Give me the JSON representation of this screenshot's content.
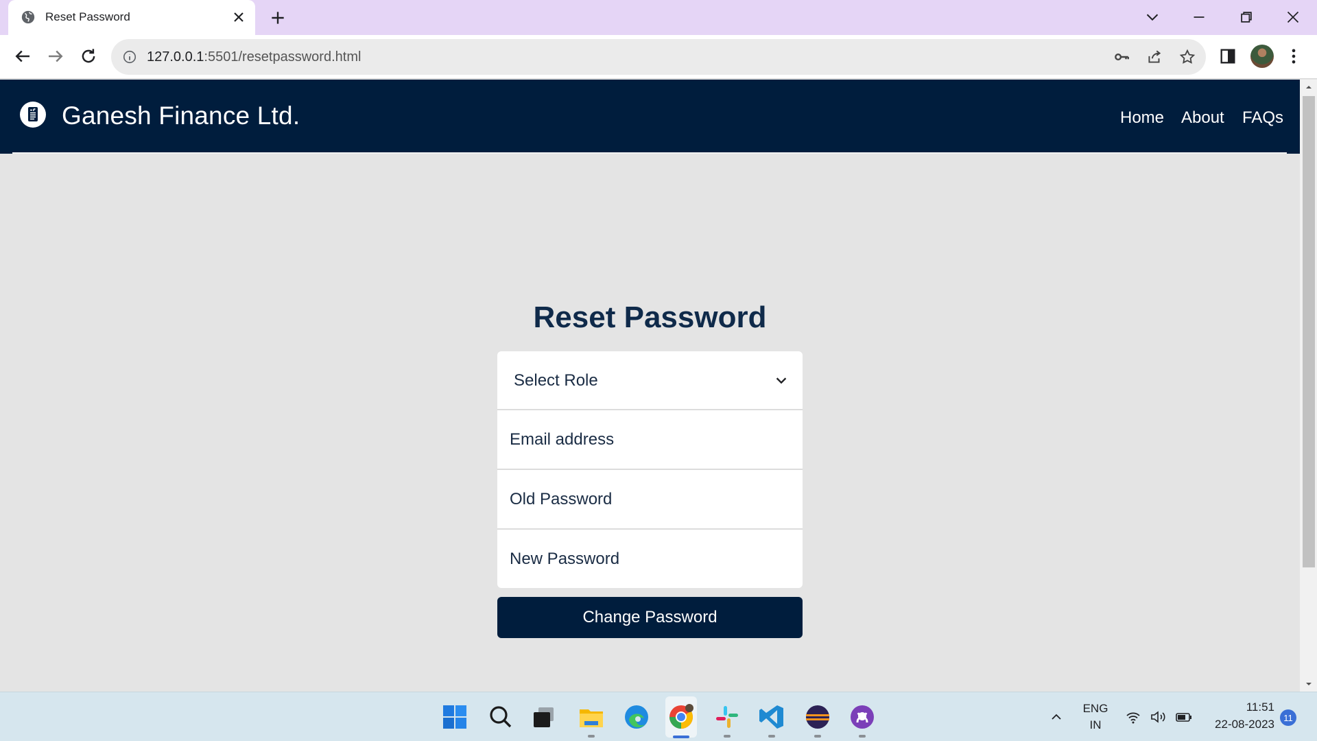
{
  "browser": {
    "tab_title": "Reset Password",
    "url_host": "127.0.0.1",
    "url_rest": ":5501/resetpassword.html"
  },
  "site": {
    "brand": "Ganesh Finance Ltd.",
    "nav": [
      {
        "label": "Home"
      },
      {
        "label": "About"
      },
      {
        "label": "FAQs"
      }
    ],
    "colors": {
      "navbar": "#001d3d",
      "button": "#001d3d",
      "background": "#e4e4e4"
    }
  },
  "form": {
    "title": "Reset Password",
    "role_select": "Select Role",
    "email_placeholder": "Email address",
    "old_password_placeholder": "Old Password",
    "new_password_placeholder": "New Password",
    "submit_label": "Change Password"
  },
  "taskbar": {
    "apps": [
      "start-icon",
      "search-icon",
      "task-view-icon",
      "file-explorer-icon",
      "edge-icon",
      "chrome-icon",
      "slack-icon",
      "vscode-icon",
      "eclipse-icon",
      "github-desktop-icon"
    ],
    "language": "ENG",
    "region": "IN",
    "time": "11:51",
    "date": "22-08-2023",
    "notifications": "11"
  }
}
